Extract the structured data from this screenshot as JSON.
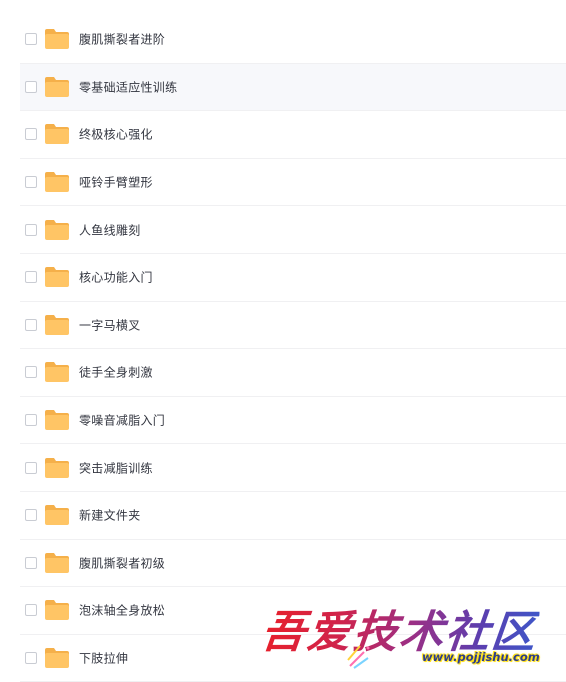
{
  "folders": [
    {
      "name": "腹肌撕裂者进阶"
    },
    {
      "name": "零基础适应性训练"
    },
    {
      "name": "终极核心强化"
    },
    {
      "name": "哑铃手臂塑形"
    },
    {
      "name": "人鱼线雕刻"
    },
    {
      "name": "核心功能入门"
    },
    {
      "name": "一字马横叉"
    },
    {
      "name": "徒手全身刺激"
    },
    {
      "name": "零噪音减脂入门"
    },
    {
      "name": "突击减脂训练"
    },
    {
      "name": "新建文件夹"
    },
    {
      "name": "腹肌撕裂者初级"
    },
    {
      "name": "泡沫轴全身放松"
    },
    {
      "name": "下肢拉伸"
    }
  ],
  "hovered_index": 1,
  "colors": {
    "folder": "#ffc565",
    "folder_tab": "#f5b04a",
    "row_border": "#f0f0f2",
    "row_hover": "#f7f8fb",
    "label": "#333640"
  },
  "icons": {
    "folder": "folder-icon",
    "checkbox": "checkbox-icon"
  },
  "watermark": {
    "text": "吾爱技术社区",
    "url": "www.pojjishu.com"
  }
}
